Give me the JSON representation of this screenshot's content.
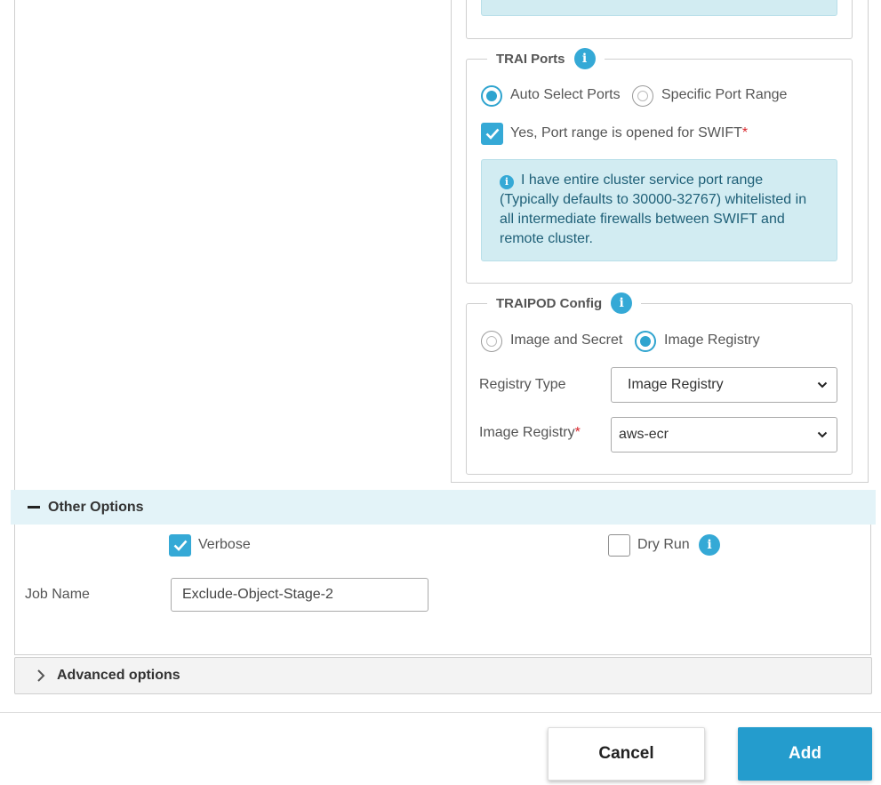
{
  "trai_ports": {
    "legend": "TRAI Ports",
    "info_icon": "info-icon",
    "radio_auto_label": "Auto Select Ports",
    "radio_auto_selected": true,
    "radio_specific_label": "Specific Port Range",
    "radio_specific_selected": false,
    "checkbox_label": "Yes, Port range is opened for SWIFT",
    "checkbox_required_mark": "*",
    "checkbox_checked": true,
    "info_text": "I have entire cluster service port range (Typically defaults to 30000-32767) whitelisted in all intermediate firewalls between SWIFT and remote cluster."
  },
  "traipod_config": {
    "legend": "TRAIPOD Config",
    "info_icon": "info-icon",
    "radio_image_secret_label": "Image and Secret",
    "radio_image_secret_selected": false,
    "radio_image_registry_label": "Image Registry",
    "radio_image_registry_selected": true,
    "registry_type_label": "Registry Type",
    "registry_type_value": "Image Registry",
    "image_registry_label": "Image Registry",
    "image_registry_required_mark": "*",
    "image_registry_value": "aws-ecr"
  },
  "other_options": {
    "title": "Other Options",
    "verbose_label": "Verbose",
    "verbose_checked": true,
    "dry_run_label": "Dry Run",
    "dry_run_checked": false,
    "job_name_label": "Job Name",
    "job_name_value": "Exclude-Object-Stage-2"
  },
  "advanced_options": {
    "title": "Advanced options",
    "expanded": false
  },
  "footer": {
    "cancel_label": "Cancel",
    "add_label": "Add"
  },
  "colors": {
    "accent": "#35a9d6",
    "primary_button": "#249ccd",
    "info_bg": "#d2ecf2",
    "section_bg": "#e3f3f8",
    "required": "#d9262c"
  }
}
